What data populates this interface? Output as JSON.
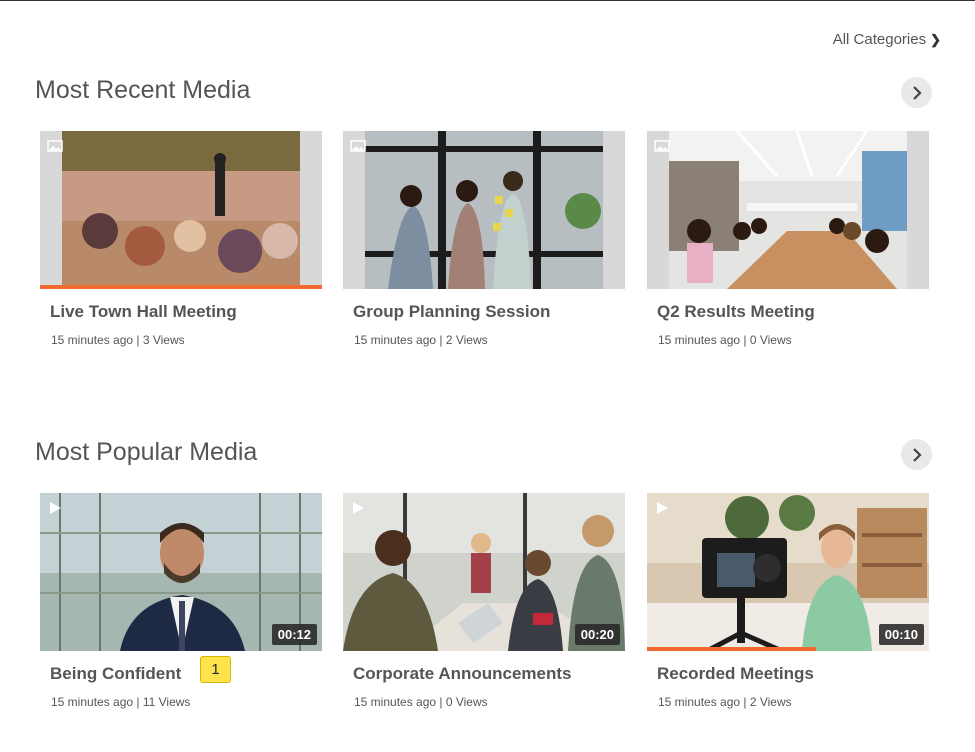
{
  "header": {
    "all_categories_label": "All Categories"
  },
  "sections": [
    {
      "title": "Most Recent Media",
      "cards": [
        {
          "title": "Live Town Hall Meeting",
          "meta": "15 minutes ago | 3 Views",
          "type_icon": "image-icon",
          "duration": "",
          "progress": 1.0
        },
        {
          "title": "Group Planning Session",
          "meta": "15 minutes ago | 2 Views",
          "type_icon": "image-icon",
          "duration": "",
          "progress": 0
        },
        {
          "title": "Q2 Results Meeting",
          "meta": "15 minutes ago | 0 Views",
          "type_icon": "image-icon",
          "duration": "",
          "progress": 0
        }
      ]
    },
    {
      "title": "Most Popular Media",
      "cards": [
        {
          "title": "Being Confident",
          "meta": "15 minutes ago | 11 Views",
          "type_icon": "play-icon",
          "duration": "00:12",
          "progress": 0
        },
        {
          "title": "Corporate Announcements",
          "meta": "15 minutes ago | 0 Views",
          "type_icon": "play-icon",
          "duration": "00:20",
          "progress": 0
        },
        {
          "title": "Recorded Meetings",
          "meta": "15 minutes ago | 2 Views",
          "type_icon": "play-icon",
          "duration": "00:10",
          "progress": 0.6
        }
      ]
    }
  ],
  "annotation_badge": "1",
  "colors": {
    "accent": "#f26a2e",
    "badge": "#ffe34d"
  }
}
